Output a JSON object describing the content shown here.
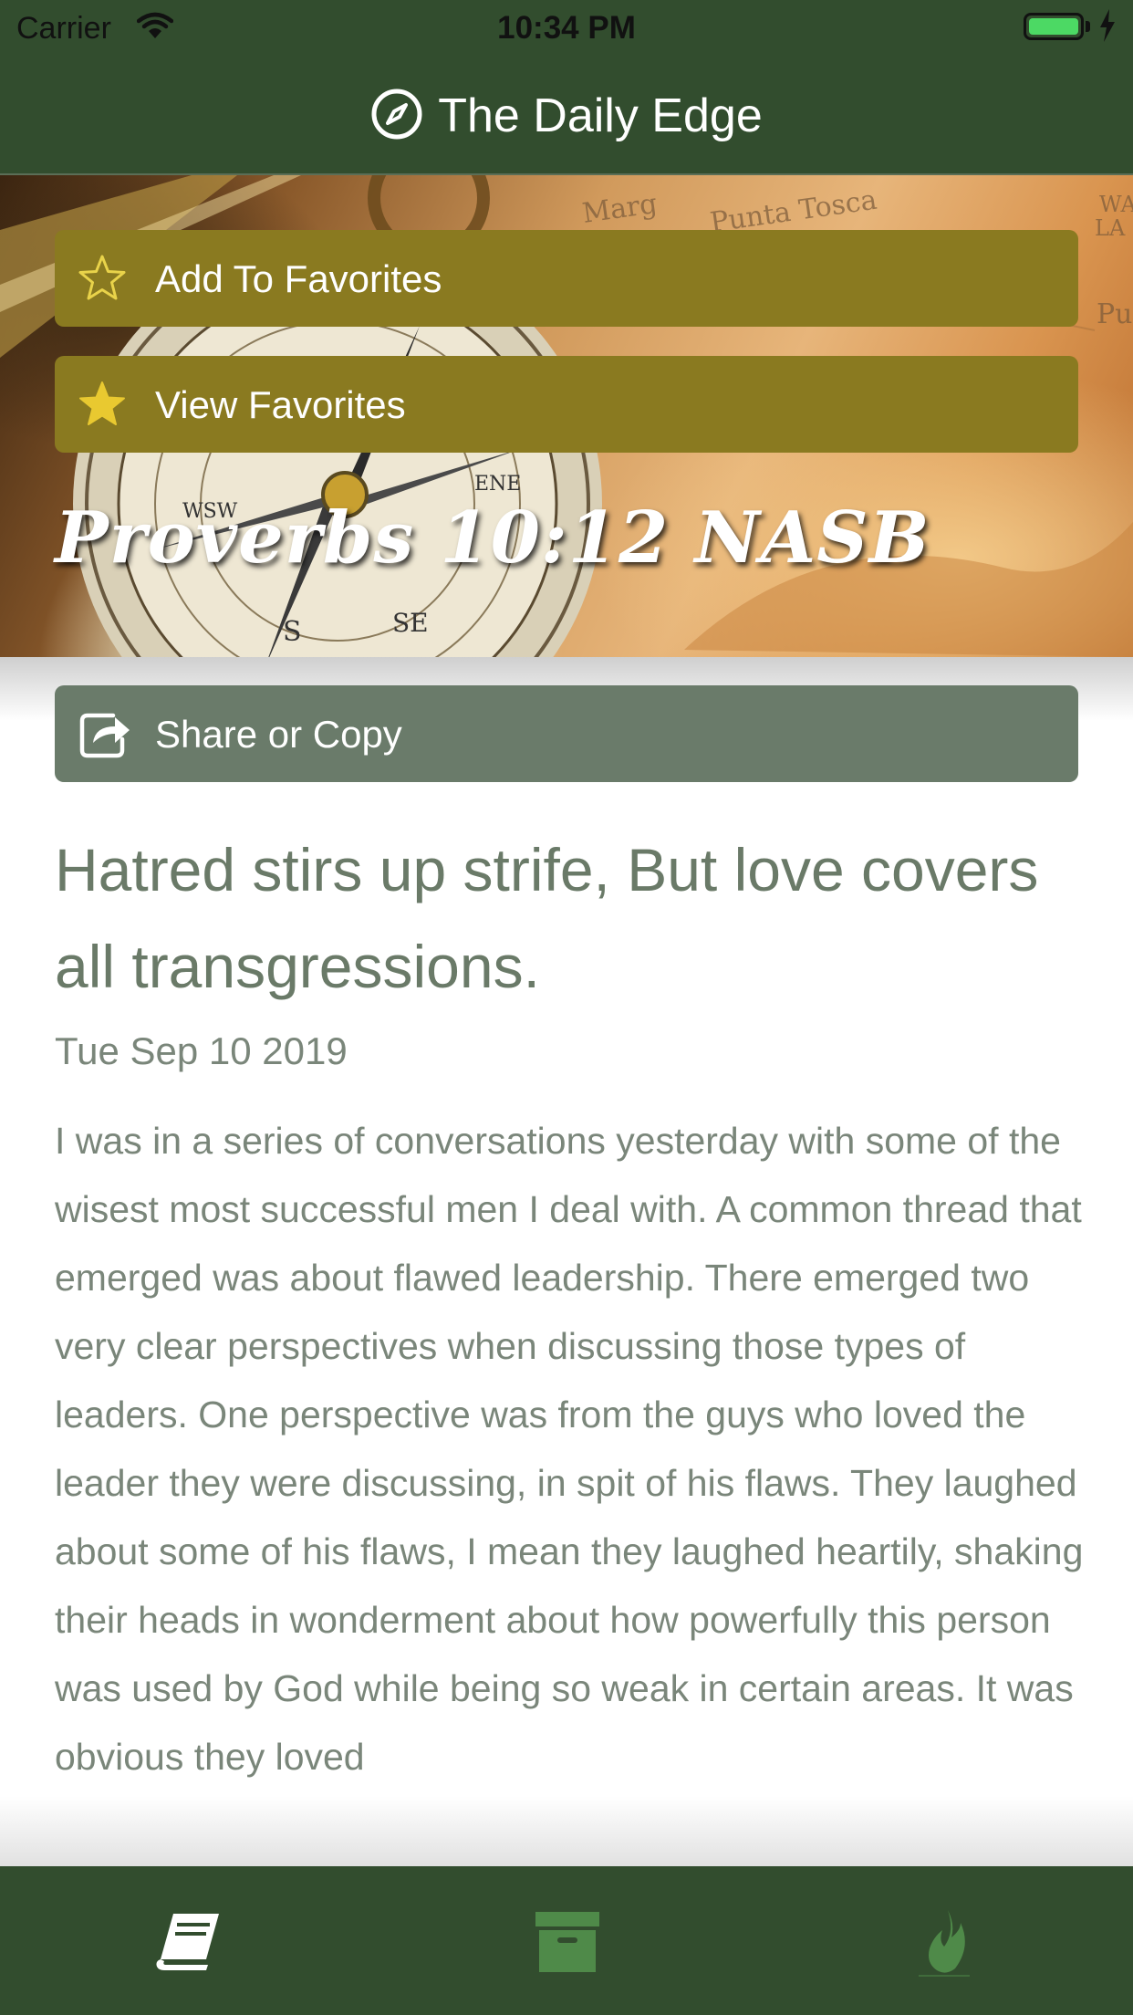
{
  "status_bar": {
    "carrier": "Carrier",
    "time": "10:34 PM",
    "battery_color": "#4cd964"
  },
  "nav": {
    "title": "The Daily Edge",
    "icon": "compass-icon"
  },
  "hero": {
    "map_labels": [
      "Marg",
      "Punta Tosca",
      "WA",
      "LA",
      "Pu"
    ],
    "add_favorites_label": "Add To Favorites",
    "view_favorites_label": "View Favorites",
    "verse_reference": "Proverbs 10:12 NASB"
  },
  "share": {
    "label": "Share or Copy",
    "icon": "share-icon"
  },
  "devotional": {
    "verse_text": "Hatred stirs up strife, But love covers all transgressions.",
    "date": "Tue Sep 10 2019",
    "body": "I was in a series of conversations yesterday with some of the wisest most successful men I deal with. A common thread that emerged was about flawed leadership. There emerged two very clear perspectives when discussing those types of leaders. One perspective was from the guys who loved the leader they were discussing, in spit of his flaws. They laughed about some of his flaws, I mean they laughed heartily, shaking their heads in wonderment about how powerfully this person was used by God while being so weak in certain areas. It was obvious they loved"
  },
  "tab_bar": {
    "tabs": [
      {
        "icon": "book-icon",
        "selected": true
      },
      {
        "icon": "archive-icon",
        "selected": false
      },
      {
        "icon": "flame-icon",
        "selected": false
      }
    ],
    "selected_color": "#ffffff",
    "unselected_color": "#4f8a49"
  },
  "colors": {
    "nav_background": "#324d2e",
    "gold_button": "#8a7a20",
    "share_button": "#6a7b6a",
    "text": "#6a7a68"
  }
}
